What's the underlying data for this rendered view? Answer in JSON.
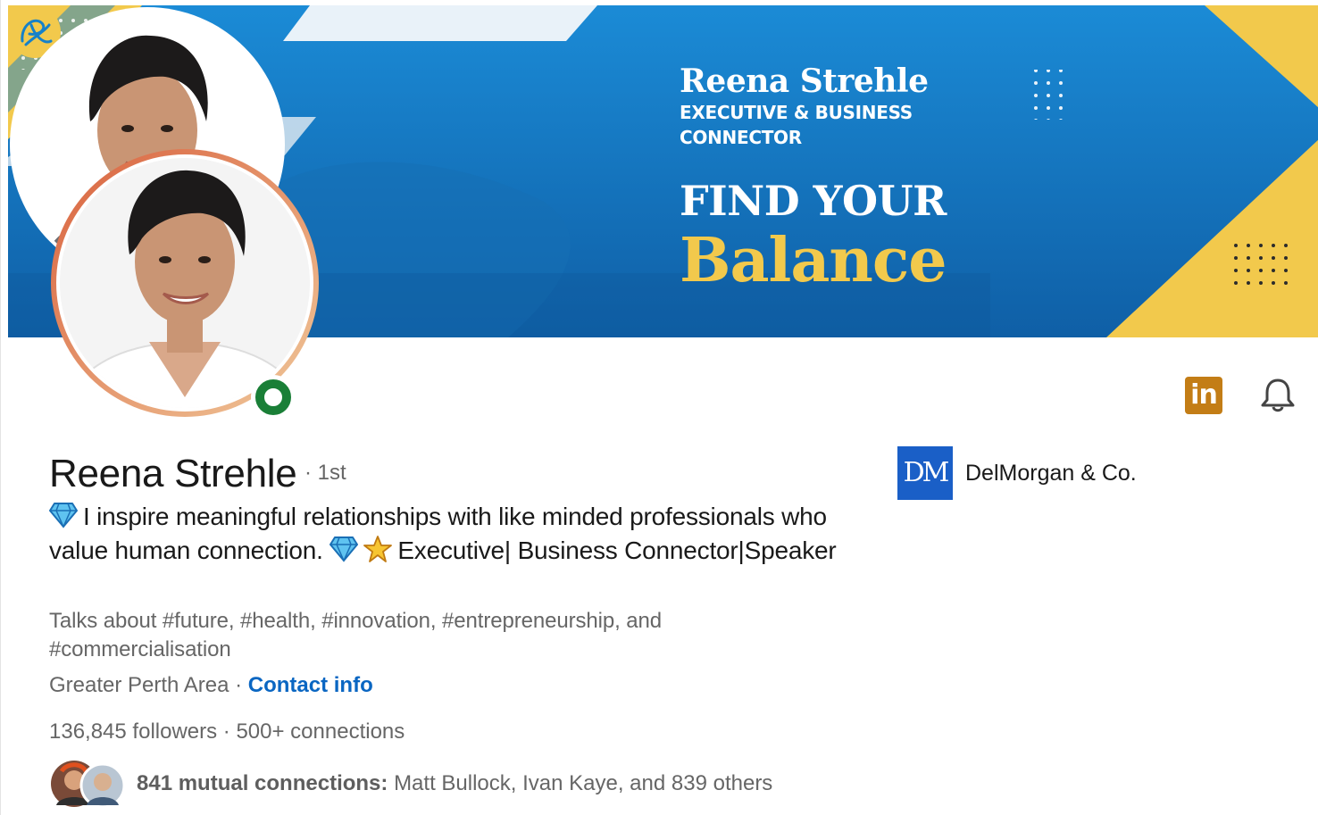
{
  "banner": {
    "name": "Reena Strehle",
    "role": "EXECUTIVE & BUSINESS CONNECTOR",
    "tagline_top": "FIND YOUR",
    "tagline_bottom": "Balance",
    "colors": {
      "blue": "#1681c9",
      "yellow": "#f2c94c"
    }
  },
  "profile": {
    "name": "Reena Strehle",
    "degree": "· 1st",
    "headline_part1": "I inspire meaningful relationships with like minded professionals who value human connection.",
    "headline_part2": "Executive| Business Connector|Speaker",
    "talks_about": "Talks about #future, #health, #innovation, #entrepreneurship, and #commercialisation",
    "location": "Greater Perth Area",
    "separator": " · ",
    "contact_info": "Contact info",
    "followers": "136,845 followers",
    "connections": "500+ connections",
    "mutual_label": "841 mutual connections:",
    "mutual_names": "Matt Bullock, Ivan Kaye, and 839 others",
    "open_to_work_color": "#1a7f37"
  },
  "actions": {
    "linkedin_badge": "in",
    "linkedin_color": "#c37d16",
    "bell_icon": "bell-icon"
  },
  "company": {
    "logo_text": "DM",
    "name": "DelMorgan & Co.",
    "color": "#1a5fc7"
  }
}
